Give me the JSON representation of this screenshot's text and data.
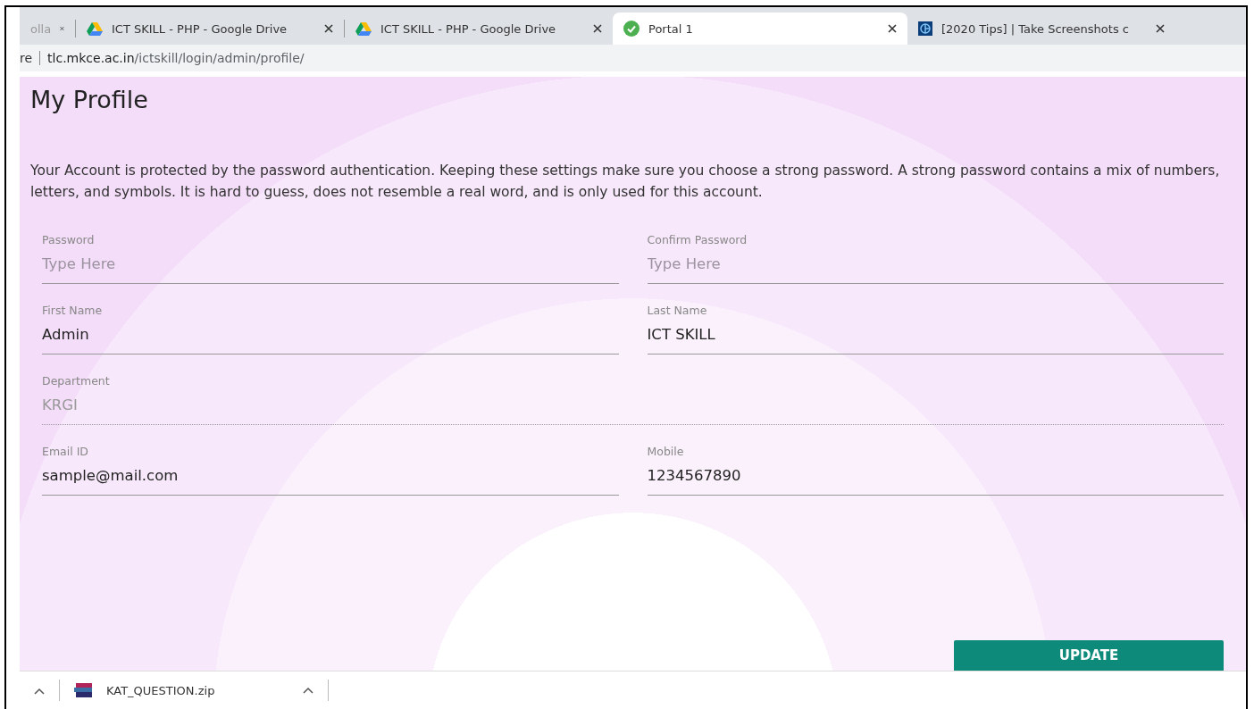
{
  "tabs": [
    {
      "title": "olla",
      "kind": "plain",
      "selected": false
    },
    {
      "title": "ICT SKILL - PHP - Google Drive",
      "kind": "drive",
      "selected": false
    },
    {
      "title": "ICT SKILL - PHP - Google Drive",
      "kind": "drive",
      "selected": false
    },
    {
      "title": "Portal 1",
      "kind": "check",
      "selected": true
    },
    {
      "title": "[2020 Tips] | Take Screenshots c",
      "kind": "site",
      "selected": false
    }
  ],
  "address_bar": {
    "prefix": "re",
    "host": "tlc.mkce.ac.in",
    "path": "/ictskill/login/admin/profile/"
  },
  "page": {
    "title": "My Profile",
    "description": "Your Account is protected by the password authentication. Keeping these settings make sure you choose a strong password. A strong password contains a mix of numbers, letters, and symbols. It is hard to guess, does not resemble a real word, and is only used for this account.",
    "fields": [
      {
        "label": "Password",
        "placeholder": "Type Here",
        "kind": "password",
        "disabled": false
      },
      {
        "label": "Confirm Password",
        "placeholder": "Type Here",
        "kind": "password",
        "disabled": false
      },
      {
        "label": "First Name",
        "value": "Admin",
        "kind": "text",
        "disabled": false
      },
      {
        "label": "Last Name",
        "value": "ICT SKILL",
        "kind": "text",
        "disabled": false
      },
      {
        "label": "Department",
        "value": "KRGI",
        "kind": "wide",
        "disabled": true
      },
      {
        "label": "Email ID",
        "value": "sample@mail.com",
        "kind": "text",
        "disabled": false
      },
      {
        "label": "Mobile",
        "value": "1234567890",
        "kind": "text",
        "disabled": false
      }
    ],
    "button": "UPDATE"
  },
  "downloads": [
    {
      "file": "KAT_QUESTION.zip"
    }
  ]
}
